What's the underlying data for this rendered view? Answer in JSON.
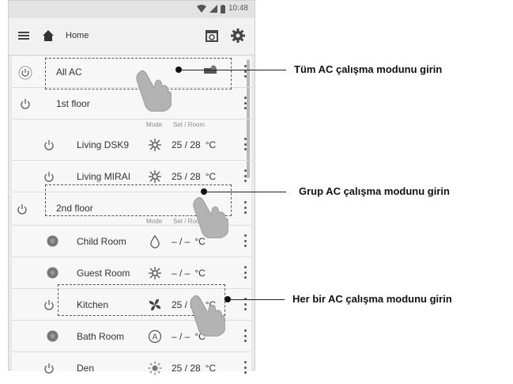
{
  "status_bar": {
    "time": "10:48"
  },
  "app_bar": {
    "title": "Home"
  },
  "list": {
    "all_ac": {
      "label": "All AC"
    },
    "floor1": {
      "label": "1st floor"
    },
    "floor2": {
      "label": "2nd floor"
    },
    "column_headers": {
      "mode": "Mode",
      "set_room": "Set / Room"
    },
    "units": [
      {
        "name": "Living DSK9",
        "temp": "25 / 28",
        "unit": "°C"
      },
      {
        "name": "Living MIRAI",
        "temp": "25 / 28",
        "unit": "°C"
      },
      {
        "name": "Child Room",
        "temp": "– / –",
        "unit": "°C"
      },
      {
        "name": "Guest Room",
        "temp": "– / –",
        "unit": "°C"
      },
      {
        "name": "Kitchen",
        "temp": "25 / 28",
        "unit": "°C"
      },
      {
        "name": "Bath Room",
        "temp": "– / –",
        "unit": "°C"
      },
      {
        "name": "Den",
        "temp": "25 / 28",
        "unit": "°C"
      }
    ]
  },
  "callouts": {
    "all": "Tüm AC çalışma modunu girin",
    "group": "Grup AC çalışma modunu girin",
    "each": "Her bir AC çalışma modunu girin"
  },
  "icons": [
    "menu-icon",
    "home-icon",
    "calendar-icon",
    "gear-icon",
    "power-icon",
    "more-icon",
    "fan-icon",
    "dry-icon",
    "auto-icon",
    "sun-icon",
    "tap-hand-icon"
  ]
}
